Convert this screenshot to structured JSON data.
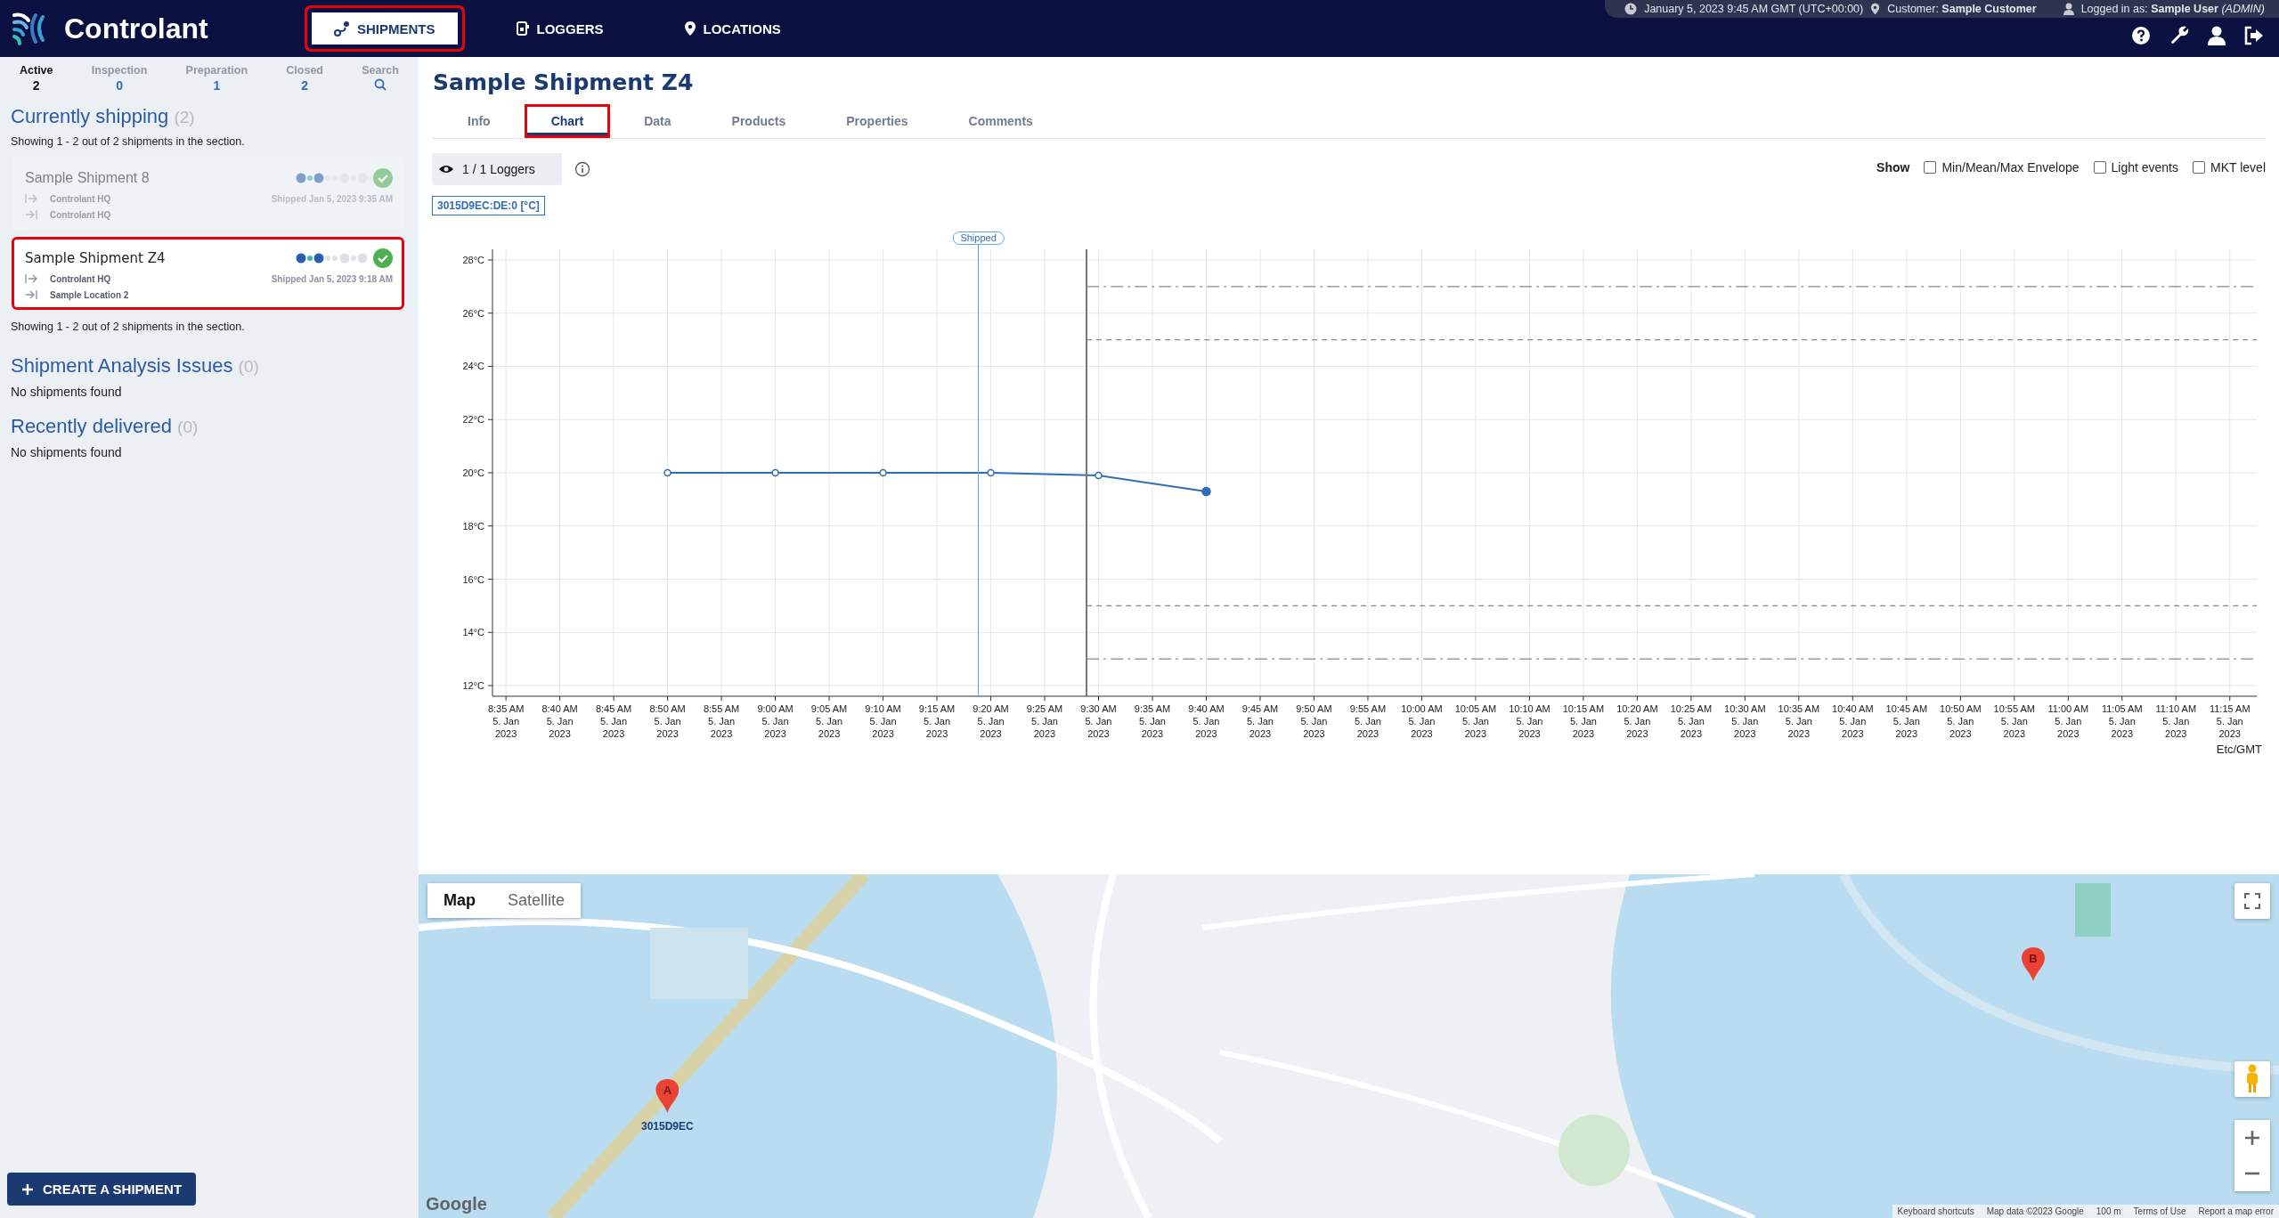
{
  "topbar": {
    "brand": "Controlant",
    "nav": [
      {
        "label": "SHIPMENTS",
        "selected": true
      },
      {
        "label": "LOGGERS",
        "selected": false
      },
      {
        "label": "LOCATIONS",
        "selected": false
      }
    ],
    "info": {
      "datetime": "January 5, 2023 9:45 AM GMT (UTC+00:00)",
      "customer_label": "Customer:",
      "customer": "Sample Customer",
      "login_label": "Logged in as:",
      "user": "Sample User",
      "role": "(ADMIN)"
    }
  },
  "sidebar": {
    "filters": [
      {
        "label": "Active",
        "count": "2",
        "kind": "count",
        "selected": true
      },
      {
        "label": "Inspection",
        "count": "0",
        "kind": "count",
        "selected": false
      },
      {
        "label": "Preparation",
        "count": "1",
        "kind": "count",
        "selected": false
      },
      {
        "label": "Closed",
        "count": "2",
        "kind": "count",
        "selected": false
      },
      {
        "label": "Search",
        "kind": "search",
        "selected": false
      }
    ],
    "sections": [
      {
        "title": "Currently shipping",
        "count": "(2)",
        "summary": "Showing 1 - 2 out of 2 shipments in the section.",
        "shipments": [
          {
            "name": "Sample Shipment 8",
            "origin": "Controlant HQ",
            "destination": "Controlant HQ",
            "shipped": "Shipped Jan 5, 2023 9:35 AM",
            "selected": false
          },
          {
            "name": "Sample Shipment Z4",
            "origin": "Controlant HQ",
            "destination": "Sample Location 2",
            "shipped": "Shipped Jan 5, 2023 9:18 AM",
            "selected": true
          }
        ],
        "footer": "Showing 1 - 2 out of 2 shipments in the section."
      },
      {
        "title": "Shipment Analysis Issues",
        "count": "(0)",
        "empty": "No shipments found"
      },
      {
        "title": "Recently delivered",
        "count": "(0)",
        "empty": "No shipments found"
      }
    ],
    "create_button": "CREATE A SHIPMENT"
  },
  "main": {
    "title": "Sample Shipment Z4",
    "tabs": [
      {
        "label": "Info",
        "selected": false
      },
      {
        "label": "Chart",
        "selected": true
      },
      {
        "label": "Data",
        "selected": false
      },
      {
        "label": "Products",
        "selected": false
      },
      {
        "label": "Properties",
        "selected": false
      },
      {
        "label": "Comments",
        "selected": false
      }
    ],
    "loggers_button": "1 / 1 Loggers",
    "show": {
      "label": "Show",
      "options": [
        {
          "label": "Min/Mean/Max Envelope",
          "checked": false
        },
        {
          "label": "Light events",
          "checked": false
        },
        {
          "label": "MKT level",
          "checked": false
        }
      ]
    },
    "chart_data": {
      "type": "line",
      "categories": [
        "8:35 AM\n5. Jan\n2023",
        "8:40 AM\n5. Jan\n2023",
        "8:45 AM\n5. Jan\n2023",
        "8:50 AM\n5. Jan\n2023",
        "8:55 AM\n5. Jan\n2023",
        "9:00 AM\n5. Jan\n2023",
        "9:05 AM\n5. Jan\n2023",
        "9:10 AM\n5. Jan\n2023",
        "9:15 AM\n5. Jan\n2023",
        "9:20 AM\n5. Jan\n2023",
        "9:25 AM\n5. Jan\n2023",
        "9:30 AM\n5. Jan\n2023",
        "9:35 AM\n5. Jan\n2023",
        "9:40 AM\n5. Jan\n2023",
        "9:45 AM\n5. Jan\n2023",
        "9:50 AM\n5. Jan\n2023",
        "9:55 AM\n5. Jan\n2023",
        "10:00 AM\n5. Jan\n2023",
        "10:05 AM\n5. Jan\n2023",
        "10:10 AM\n5. Jan\n2023",
        "10:15 AM\n5. Jan\n2023",
        "10:20 AM\n5. Jan\n2023",
        "10:25 AM\n5. Jan\n2023",
        "10:30 AM\n5. Jan\n2023",
        "10:35 AM\n5. Jan\n2023",
        "10:40 AM\n5. Jan\n2023",
        "10:45 AM\n5. Jan\n2023",
        "10:50 AM\n5. Jan\n2023",
        "10:55 AM\n5. Jan\n2023",
        "11:00 AM\n5. Jan\n2023",
        "11:05 AM\n5. Jan\n2023",
        "11:10 AM\n5. Jan\n2023",
        "11:15 AM\n5. Jan\n2023"
      ],
      "yticks": [
        {
          "value": 12,
          "label": "12°C"
        },
        {
          "value": 14,
          "label": "14°C"
        },
        {
          "value": 16,
          "label": "16°C"
        },
        {
          "value": 18,
          "label": "18°C"
        },
        {
          "value": 20,
          "label": "20°C"
        },
        {
          "value": 22,
          "label": "22°C"
        },
        {
          "value": 24,
          "label": "24°C"
        },
        {
          "value": 26,
          "label": "26°C"
        },
        {
          "value": 28,
          "label": "28°C"
        }
      ],
      "ylim": [
        11.6,
        28.4
      ],
      "grid": true,
      "series": [
        {
          "name": "3015D9EC:DE:0 [°C]",
          "color": "#2f6db5",
          "marker": true,
          "values": [
            null,
            null,
            null,
            20,
            null,
            20,
            null,
            20,
            null,
            20,
            null,
            19.9,
            null,
            19.3,
            null,
            null,
            null,
            null,
            null,
            null,
            null,
            null,
            null,
            null,
            null,
            null,
            null,
            null,
            null,
            null,
            null,
            null,
            null
          ]
        }
      ],
      "ref_lines": [
        {
          "axis": "y",
          "value": 27
        },
        {
          "axis": "y",
          "value": 25
        },
        {
          "axis": "y",
          "value": 15
        },
        {
          "axis": "y",
          "value": 13
        }
      ]
    },
    "shipped_marker": "Shipped",
    "timezone": "Etc/GMT"
  },
  "map": {
    "kind": "picture",
    "map_types": [
      {
        "label": "Map",
        "selected": true
      },
      {
        "label": "Satellite",
        "selected": false
      }
    ],
    "markers": [
      {
        "label": "A",
        "caption": "3015D9EC"
      },
      {
        "label": "B"
      }
    ],
    "logo": "Google",
    "attribution": [
      "Keyboard shortcuts",
      "Map data ©2023 Google",
      "100 m",
      "Terms of Use",
      "Report a map error"
    ]
  }
}
